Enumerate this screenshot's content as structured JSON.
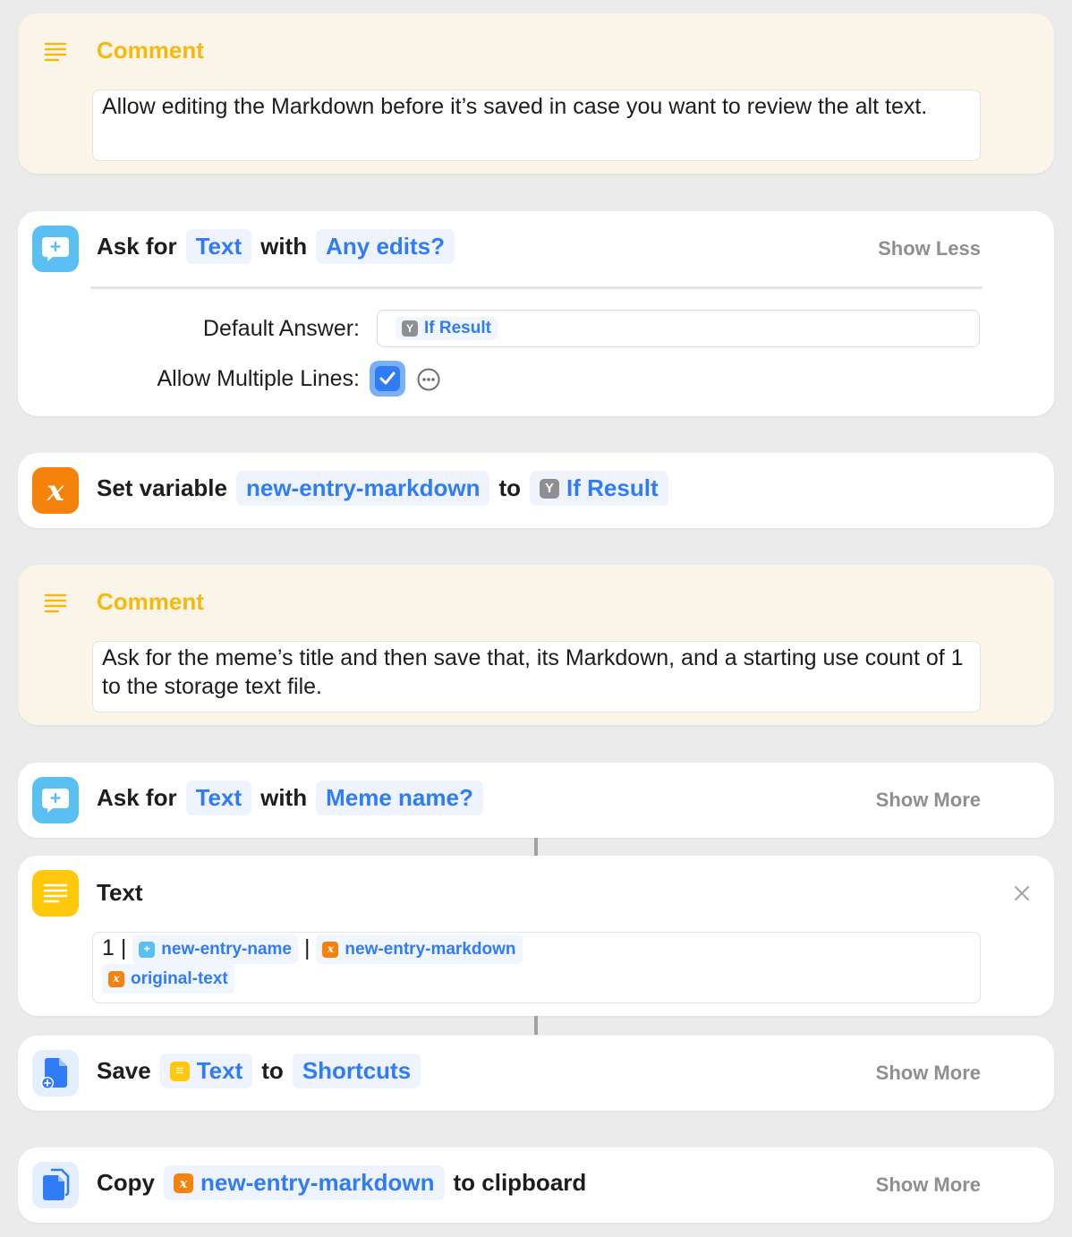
{
  "comment1": {
    "title": "Comment",
    "text": "Allow editing the Markdown before it’s saved in case you want to review the alt text."
  },
  "ask1": {
    "verb": "Ask for",
    "type_token": "Text",
    "with": "with",
    "prompt_token": "Any edits?",
    "toggle": "Show Less",
    "default_answer_label": "Default Answer:",
    "default_answer_value": "If Result",
    "multiline_label": "Allow Multiple Lines:",
    "multiline_checked": true
  },
  "setvar": {
    "verb": "Set variable",
    "variable": "new-entry-markdown",
    "to": "to",
    "value": "If Result"
  },
  "comment2": {
    "title": "Comment",
    "text": "Ask for the meme’s title and then save that, its Markdown, and a starting use count of 1 to the storage text file."
  },
  "ask2": {
    "verb": "Ask for",
    "type_token": "Text",
    "with": "with",
    "prompt_token": "Meme name?",
    "toggle": "Show More"
  },
  "text_action": {
    "title": "Text",
    "prefix": "1 |",
    "var1": "new-entry-name",
    "sep": "|",
    "var2": "new-entry-markdown",
    "var3": "original-text"
  },
  "save": {
    "verb": "Save",
    "item": "Text",
    "to": "to",
    "dest": "Shortcuts",
    "toggle": "Show More"
  },
  "copy": {
    "verb": "Copy",
    "item": "new-entry-markdown",
    "suffix": "to clipboard",
    "toggle": "Show More"
  },
  "colors": {
    "accent_blue": "#2f7cf6",
    "comment_yellow": "#f5b90d",
    "comment_bg": "#faf5e8",
    "variable_orange": "#f5820b",
    "ask_blue": "#5ac0f4",
    "text_yellow": "#ffc80a"
  }
}
